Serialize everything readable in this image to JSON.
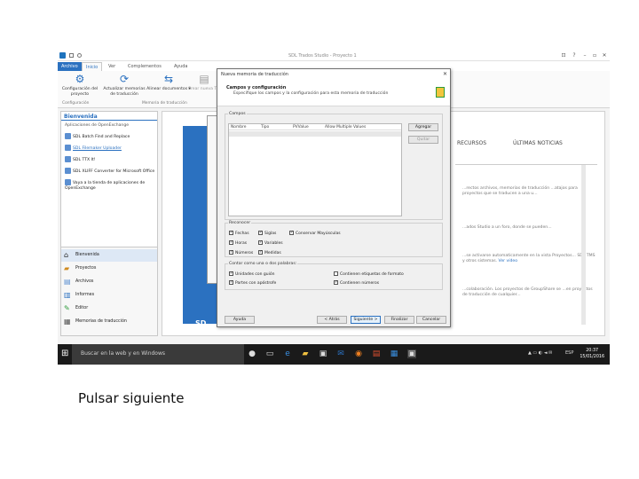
{
  "window": {
    "title": "SDL Trados Studio - Proyecto 1",
    "controls": [
      "⊡",
      "?",
      "–",
      "▫",
      "✕"
    ]
  },
  "ribbon": {
    "tabs": [
      "Archivo",
      "Inicio",
      "Ver",
      "Complementos",
      "Ayuda"
    ],
    "buttons": [
      {
        "label": "Configuración del proyecto",
        "icon": "gear-icon"
      },
      {
        "label": "Actualizar memorias de traducción",
        "icon": "refresh-icon"
      },
      {
        "label": "Alinear documentos ▾",
        "icon": "align-icon"
      },
      {
        "label": "Crear nueva TM",
        "icon": "new-tm-icon"
      }
    ],
    "groups": [
      "Configuración",
      "Memoria de traducción"
    ]
  },
  "leftnav": {
    "header": "Bienvenida",
    "subheader": "Aplicaciones de OpenExchange",
    "links": [
      "SDL Batch Find and Replace",
      "SDL Filemaker Uploader",
      "SDL TTX It!",
      "SDL XLIFF Converter for Microsoft Office",
      "Vaya a la tienda de aplicaciones de OpenExchange"
    ],
    "items": [
      "Bienvenida",
      "Proyectos",
      "Archivos",
      "Informes",
      "Editor",
      "Memorias de traducción"
    ]
  },
  "content": {
    "sd_text": "SD",
    "tabs": [
      "RECURSOS",
      "ÚLTIMAS NOTICIAS"
    ],
    "texts": [
      "...rectos archivos, memorias de traducción ...atajos para proyectos que se traducen a una u...",
      "...ados Studio a un foro, donde se pueden...",
      "...se activarse automaticamente en la vista Proyectos... SDL TMS y otros sistemas.",
      "...colaboración. Los proyectos de GroupShare se ...en proyectos de traducción de cualquier..."
    ],
    "link_text": "Ver vídeo"
  },
  "dialog": {
    "title": "Nueva memoria de traducción",
    "heading": "Campos y configuración",
    "subheading": "Especifique los campos y la configuración para esta memoria de traducción",
    "fields_legend": "Campos",
    "columns": [
      "Nombre",
      "Tipo",
      "PVValue",
      "Allow Multiple Values"
    ],
    "add_button": "Agregar",
    "delete_button": "Quitar",
    "recognize_legend": "Reconocer",
    "recognize": [
      {
        "label": "Fechas",
        "checked": true
      },
      {
        "label": "Siglas",
        "checked": true
      },
      {
        "label": "Conservar Mayúsculas",
        "checked": true
      },
      {
        "label": "Horas",
        "checked": true
      },
      {
        "label": "Variables",
        "checked": true
      },
      {
        "label": "Números",
        "checked": true
      },
      {
        "label": "Medidas",
        "checked": true
      }
    ],
    "words_legend": "Contar como una o dos palabras:",
    "words": [
      {
        "label": "Unidades con guión",
        "checked": true
      },
      {
        "label": "Contienen etiquetas de formato",
        "checked": false
      },
      {
        "label": "Partes con apóstrofe",
        "checked": true
      },
      {
        "label": "Contienen números",
        "checked": true
      }
    ],
    "buttons": {
      "help": "Ayuda",
      "back": "< Atrás",
      "next": "Siguiente >",
      "finish": "Finalizar",
      "cancel": "Cancelar"
    }
  },
  "taskbar": {
    "search": "Buscar en la web y en Windows",
    "lang": "ESP",
    "time": "20:37",
    "date": "15/01/2016"
  },
  "caption": "Pulsar siguiente",
  "colors": {
    "accent": "#2b71c0",
    "taskbar": "#1a1a1a"
  }
}
